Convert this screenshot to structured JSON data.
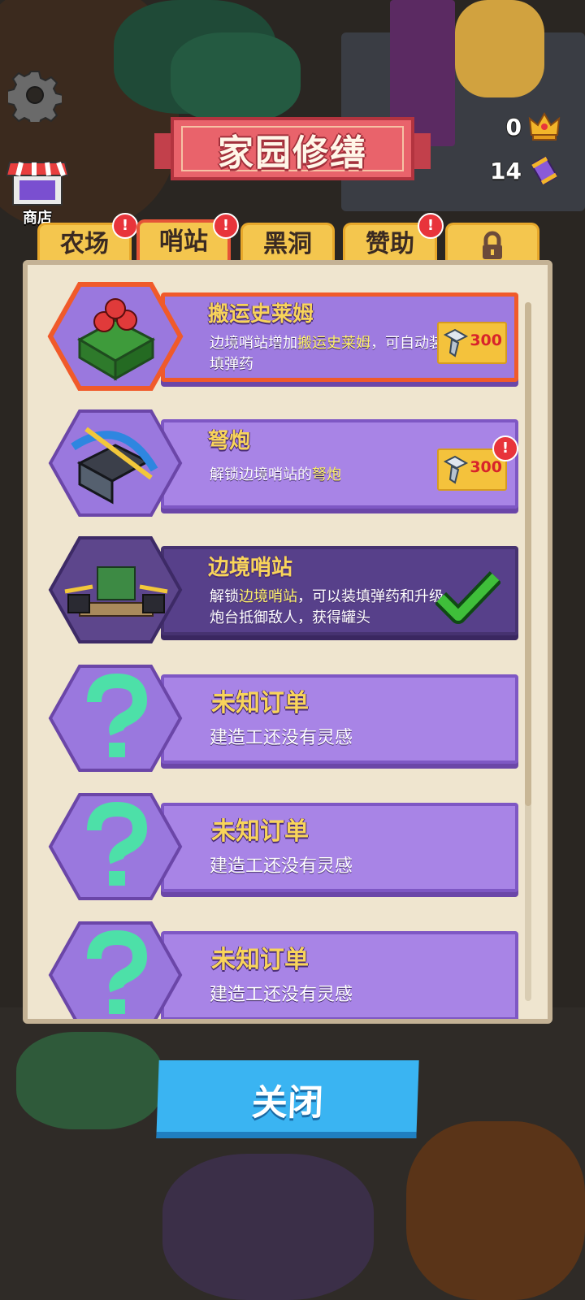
{
  "hud": {
    "shop_label": "商店",
    "crowns": "0",
    "cans": "14"
  },
  "title": "家园修缮",
  "tabs": [
    {
      "label": "农场",
      "alert": "!"
    },
    {
      "label": "哨站",
      "alert": "!"
    },
    {
      "label": "黑洞",
      "alert": ""
    },
    {
      "label": "赞助",
      "alert": "!"
    },
    {
      "label": "",
      "locked": true
    }
  ],
  "items": [
    {
      "name": "搬运史莱姆",
      "desc_pre": "边境哨站增加",
      "desc_hl": "搬运史莱姆",
      "desc_post": "，可自动装填弹药",
      "price": "300",
      "state": "selected"
    },
    {
      "name": "弩炮",
      "desc_pre": "解锁边境哨站的",
      "desc_hl": "弩炮",
      "desc_post": "",
      "price": "300",
      "price_alert": "!",
      "state": "available"
    },
    {
      "name": "边境哨站",
      "desc_pre": "解锁",
      "desc_hl": "边境哨站",
      "desc_post": "，可以装填弹药和升级炮台抵御敌人，获得罐头",
      "state": "done"
    },
    {
      "name": "未知订单",
      "desc": "建造工还没有灵感",
      "state": "unknown"
    },
    {
      "name": "未知订单",
      "desc": "建造工还没有灵感",
      "state": "unknown"
    },
    {
      "name": "未知订单",
      "desc": "建造工还没有灵感",
      "state": "unknown"
    }
  ],
  "close_label": "关闭",
  "colors": {
    "panel": "#efe5cf",
    "card": "#a884e6",
    "card_done": "#57408a",
    "tab": "#f4c64e",
    "accent_orange": "#f05a2a",
    "close_button": "#3ab4f2",
    "question": "#4de0a8"
  }
}
